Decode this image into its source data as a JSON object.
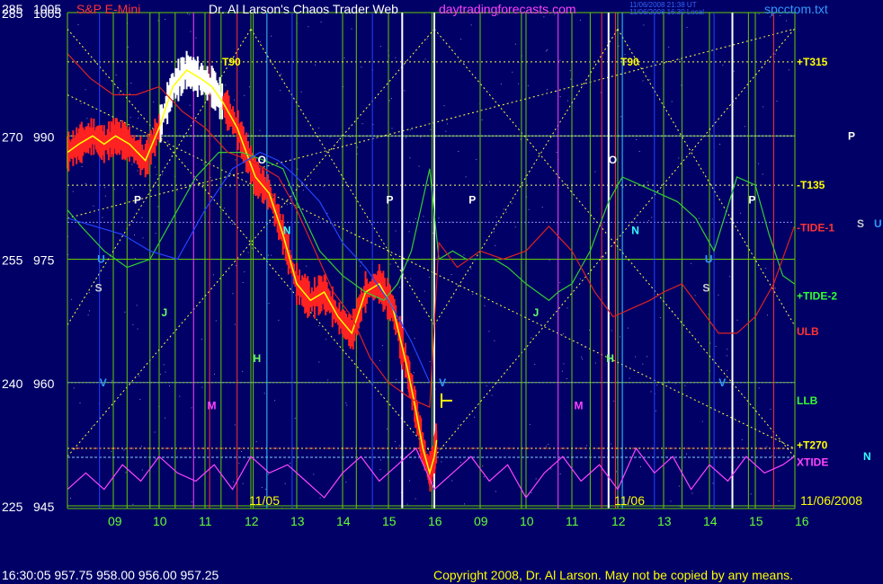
{
  "header": {
    "scale_left": "285",
    "scale_right": "1005",
    "symbol": "S&P E-Mini",
    "title": "Dr. Al Larson's Chaos Trader Web",
    "site": "daytradingforecasts.com",
    "stamp1": "11/06/2008 21:38 UT",
    "stamp2": "11/06/2008 16:30 Local",
    "file": "spcctom.txt"
  },
  "footer": {
    "quote": "16:30:05  957.75  958.00  956.00  957.25",
    "copyright": "Copyright 2008, Dr. Al Larson. May not be copied by any means."
  },
  "colors": {
    "background": "#000066",
    "price": "#ffff00",
    "grid": "#66cc00",
    "tide": "#ff3366"
  },
  "chart_data": {
    "type": "line",
    "y_labels": [
      {
        "left": "285",
        "right": "1005",
        "value": 1005
      },
      {
        "left": "270",
        "right": "990",
        "value": 990
      },
      {
        "left": "255",
        "right": "975",
        "value": 975
      },
      {
        "left": "240",
        "right": "960",
        "value": 960
      },
      {
        "left": "225",
        "right": "945",
        "value": 945
      }
    ],
    "ylim": [
      945,
      1005
    ],
    "x_ticks": [
      "09",
      "10",
      "11",
      "12",
      "13",
      "14",
      "15",
      "16",
      "09",
      "10",
      "11",
      "12",
      "13",
      "14",
      "15",
      "16"
    ],
    "date_labels": [
      "11/05",
      "11/06",
      "11/06/2008"
    ],
    "right_labels": [
      {
        "text": "+T315",
        "value": 999,
        "color": "#ffff00"
      },
      {
        "text": "-T135",
        "value": 984,
        "color": "#ffff00"
      },
      {
        "text": "-TIDE-1",
        "value": 978.8,
        "color": "#ff3333"
      },
      {
        "text": "+TIDE-2",
        "value": 970.5,
        "color": "#33ff33"
      },
      {
        "text": "ULB",
        "value": 966.2,
        "color": "#ff3333"
      },
      {
        "text": "LLB",
        "value": 957.8,
        "color": "#33ff33"
      },
      {
        "text": "+T270",
        "value": 952.4,
        "color": "#ffff00"
      },
      {
        "text": "XTIDE",
        "value": 950.3,
        "color": "#ff44ff"
      }
    ],
    "side_letters": [
      {
        "text": "P",
        "value": 990.0,
        "color": "#ffffff"
      },
      {
        "text": "S",
        "value": 979.3,
        "color": "#cccccc"
      },
      {
        "text": "U",
        "value": 979.3,
        "color": "#3399ff"
      },
      {
        "text": "N",
        "value": 951.0,
        "color": "#33ffff"
      }
    ],
    "top_markers": [
      "T90",
      "T90"
    ],
    "flux_letters": [
      {
        "text": "P",
        "x": 1.45,
        "value": 982.2,
        "color": "#ffffff"
      },
      {
        "text": "U",
        "x": 0.65,
        "value": 975.0,
        "color": "#3399ff"
      },
      {
        "text": "S",
        "x": 0.6,
        "value": 971.5,
        "color": "#cccccc"
      },
      {
        "text": "J",
        "x": 2.05,
        "value": 968.5,
        "color": "#66ff66"
      },
      {
        "text": "O",
        "x": 4.15,
        "value": 987.1,
        "color": "#ffffff"
      },
      {
        "text": "N",
        "x": 4.7,
        "value": 978.5,
        "color": "#33ffff"
      },
      {
        "text": "H",
        "x": 4.05,
        "value": 962.9,
        "color": "#66ff66"
      },
      {
        "text": "M",
        "x": 3.05,
        "value": 957.2,
        "color": "#ff44ff"
      },
      {
        "text": "V",
        "x": 0.7,
        "value": 960.0,
        "color": "#3399ff"
      },
      {
        "text": "P",
        "x": 6.95,
        "value": 982.2,
        "color": "#ffffff"
      },
      {
        "text": "P",
        "x": 8.75,
        "value": 982.2,
        "color": "#ffffff"
      },
      {
        "text": "V",
        "x": 8.1,
        "value": 960.0,
        "color": "#3399ff"
      },
      {
        "text": "J",
        "x": 10.15,
        "value": 968.5,
        "color": "#66ff66"
      },
      {
        "text": "M",
        "x": 11.05,
        "value": 957.2,
        "color": "#ff44ff"
      },
      {
        "text": "O",
        "x": 11.8,
        "value": 987.1,
        "color": "#ffffff"
      },
      {
        "text": "N",
        "x": 12.3,
        "value": 978.5,
        "color": "#33ffff"
      },
      {
        "text": "H",
        "x": 11.75,
        "value": 962.9,
        "color": "#66ff66"
      },
      {
        "text": "U",
        "x": 13.9,
        "value": 975.0,
        "color": "#3399ff"
      },
      {
        "text": "S",
        "x": 13.85,
        "value": 971.5,
        "color": "#cccccc"
      },
      {
        "text": "V",
        "x": 14.2,
        "value": 960.0,
        "color": "#3399ff"
      },
      {
        "text": "P",
        "x": 14.85,
        "value": 982.2,
        "color": "#ffffff"
      }
    ],
    "series": [
      {
        "kind": "price",
        "x": [
          0.0,
          0.25,
          0.55,
          0.8,
          1.05,
          1.35,
          1.7,
          2.0,
          2.3,
          2.6,
          2.9,
          3.15,
          3.4,
          3.7,
          3.9,
          4.1,
          4.4,
          4.7,
          5.0,
          5.3,
          5.6,
          5.9,
          6.2,
          6.5,
          6.8,
          7.1,
          7.4,
          7.55,
          7.75,
          7.9,
          8.0,
          8.05
        ],
        "values": [
          988,
          989,
          990,
          989,
          990,
          989,
          987,
          991,
          996,
          998,
          997,
          996,
          994,
          991,
          988,
          985,
          983,
          978,
          972,
          970,
          971,
          968,
          966,
          971,
          972,
          969,
          962,
          958,
          952,
          949,
          951,
          953
        ]
      },
      {
        "kind": "overlay",
        "name": "green",
        "color": "#33cc33",
        "x": [
          0.0,
          0.3,
          0.8,
          1.3,
          1.8,
          2.3,
          2.8,
          3.3,
          3.8,
          4.3,
          4.7,
          5.0,
          5.5,
          6.0,
          6.5,
          6.9,
          7.2,
          7.5,
          7.9,
          8.1,
          8.4,
          8.7,
          9.0,
          9.3,
          9.6,
          10.0,
          10.5,
          10.7,
          11.0,
          11.4,
          11.8,
          12.1,
          12.5,
          12.9,
          13.3,
          13.7,
          14.1,
          14.6,
          15.0,
          15.3,
          15.6,
          15.85
        ],
        "values": [
          981,
          979,
          976,
          974,
          975,
          980,
          985,
          988,
          988,
          987,
          986,
          982,
          976,
          973,
          971,
          970,
          972,
          976,
          986,
          975,
          976,
          975,
          975,
          975,
          974,
          972,
          970,
          971,
          972,
          976,
          982,
          985,
          984,
          983,
          982,
          980,
          976,
          985,
          984,
          978,
          973,
          972
        ]
      },
      {
        "kind": "overlay",
        "name": "red",
        "color": "#dd2222",
        "x": [
          0.0,
          0.5,
          1.0,
          1.5,
          2.0,
          2.5,
          3.0,
          3.5,
          4.0,
          4.3,
          4.6,
          5.0,
          5.4,
          5.8,
          6.2,
          6.6,
          7.0,
          7.5,
          7.9,
          8.1,
          8.5,
          9.0,
          9.5,
          10.0,
          10.5,
          11.0,
          11.5,
          11.9,
          12.3,
          12.7,
          13.0,
          13.4,
          13.8,
          14.2,
          14.6,
          15.0,
          15.4,
          15.85
        ],
        "values": [
          1000,
          997,
          995,
          995,
          996,
          993,
          991,
          988,
          987,
          986,
          985,
          981,
          976,
          971,
          968,
          963,
          960,
          958,
          957,
          977,
          974,
          976,
          975,
          976,
          979,
          976,
          971,
          968,
          969,
          970,
          971,
          972,
          969,
          966,
          966,
          968,
          972,
          979
        ]
      },
      {
        "kind": "overlay",
        "name": "blue",
        "color": "#2244ff",
        "x": [
          0.0,
          0.6,
          1.2,
          1.8,
          2.4,
          3.0,
          3.6,
          4.2,
          4.6,
          5.0,
          5.5,
          6.0,
          6.5,
          7.0,
          7.5,
          7.9
        ],
        "values": [
          980,
          979,
          978,
          976,
          975,
          981,
          986,
          988,
          987,
          985,
          982,
          977,
          974,
          970,
          965,
          960
        ]
      },
      {
        "kind": "xtide",
        "name": "XTIDE",
        "color": "#ff44ff",
        "x": [
          0.0,
          0.4,
          0.8,
          1.2,
          1.6,
          2.0,
          2.4,
          2.8,
          3.2,
          3.6,
          4.0,
          4.4,
          4.8,
          5.2,
          5.6,
          6.0,
          6.4,
          6.8,
          7.2,
          7.6,
          8.0,
          8.4,
          8.8,
          9.2,
          9.6,
          10.0,
          10.4,
          10.8,
          11.2,
          11.6,
          12.0,
          12.4,
          12.8,
          13.2,
          13.6,
          14.0,
          14.4,
          14.8,
          15.2,
          15.6,
          15.85
        ],
        "values": [
          947,
          949,
          947,
          950,
          948,
          951,
          949,
          948,
          950,
          947,
          951,
          949,
          950,
          948,
          946,
          949,
          951,
          948,
          950,
          952,
          947,
          949,
          951,
          948,
          950,
          946,
          949,
          951,
          948,
          950,
          947,
          952,
          949,
          951,
          947,
          950,
          948,
          951,
          949,
          950,
          951
        ]
      }
    ],
    "flat_lines": [
      {
        "value": 990.0,
        "color": "#ccccff",
        "dash": "2,2"
      },
      {
        "value": 984.0,
        "color": "#ffff66",
        "dash": "2,3"
      },
      {
        "value": 979.5,
        "color": "#8888ff",
        "dash": "2,2"
      },
      {
        "value": 960.0,
        "color": "#8888ff",
        "dash": "2,2"
      },
      {
        "value": 952.0,
        "color": "#ff3333",
        "dash": "2,2"
      },
      {
        "value": 950.9,
        "color": "#88ccff",
        "dash": "3,2"
      }
    ],
    "diagonals": [
      {
        "x": [
          0.0,
          15.85
        ],
        "values": [
          995,
          952
        ]
      },
      {
        "x": [
          0.0,
          15.85
        ],
        "values": [
          980,
          1003
        ]
      },
      {
        "x": [
          0.0,
          8.0
        ],
        "values": [
          951,
          1003
        ]
      },
      {
        "x": [
          0.0,
          8.0
        ],
        "values": [
          1003,
          951
        ]
      },
      {
        "x": [
          8.0,
          15.85
        ],
        "values": [
          951,
          1003
        ]
      },
      {
        "x": [
          8.0,
          15.85
        ],
        "values": [
          1003,
          951
        ]
      },
      {
        "x": [
          0.0,
          4.0
        ],
        "values": [
          967,
          1003
        ]
      },
      {
        "x": [
          4.0,
          8.0
        ],
        "values": [
          1003,
          967
        ]
      },
      {
        "x": [
          8.0,
          12.0
        ],
        "values": [
          967,
          1003
        ]
      },
      {
        "x": [
          12.0,
          15.85
        ],
        "values": [
          1003,
          967
        ]
      },
      {
        "x": [
          0.0,
          15.85
        ],
        "values": [
          999,
          999
        ]
      },
      {
        "x": [
          0.0,
          15.85
        ],
        "values": [
          952,
          952
        ]
      }
    ],
    "vlines": [
      {
        "x": 0.7,
        "color": "#2244ff"
      },
      {
        "x": 1.3,
        "color": "#66cc00"
      },
      {
        "x": 1.8,
        "color": "#66cc00"
      },
      {
        "x": 2.35,
        "color": "#66cc00"
      },
      {
        "x": 2.75,
        "color": "#ff44ff"
      },
      {
        "x": 3.1,
        "color": "#ff3333"
      },
      {
        "x": 3.35,
        "color": "#66cc00"
      },
      {
        "x": 3.7,
        "color": "#ff3333"
      },
      {
        "x": 4.05,
        "color": "#66cc00"
      },
      {
        "x": 4.35,
        "color": "#33ccff"
      },
      {
        "x": 4.9,
        "color": "#2244ff"
      },
      {
        "x": 6.3,
        "color": "#66cc00"
      },
      {
        "x": 6.65,
        "color": "#2244ff"
      },
      {
        "x": 7.3,
        "color": "#ffffff"
      },
      {
        "x": 7.95,
        "color": "#66cc00"
      },
      {
        "x": 8.0,
        "color": "#ffffff"
      },
      {
        "x": 9.0,
        "color": "#66cc00"
      },
      {
        "x": 9.9,
        "color": "#66cc00"
      },
      {
        "x": 10.7,
        "color": "#ff44ff"
      },
      {
        "x": 11.4,
        "color": "#66cc00"
      },
      {
        "x": 11.65,
        "color": "#ff3333"
      },
      {
        "x": 11.8,
        "color": "#ffffff"
      },
      {
        "x": 11.95,
        "color": "#ff3333"
      },
      {
        "x": 12.1,
        "color": "#33ccff"
      },
      {
        "x": 12.8,
        "color": "#2244ff"
      },
      {
        "x": 13.4,
        "color": "#66cc00"
      },
      {
        "x": 14.1,
        "color": "#2244ff"
      },
      {
        "x": 14.5,
        "color": "#ffffff"
      },
      {
        "x": 14.85,
        "color": "#66cc00"
      },
      {
        "x": 15.4,
        "color": "#ff3333"
      }
    ],
    "hour_grid": [
      1,
      2,
      3,
      4,
      5,
      6,
      7,
      8,
      9,
      10,
      11,
      12,
      13,
      14,
      15
    ]
  }
}
